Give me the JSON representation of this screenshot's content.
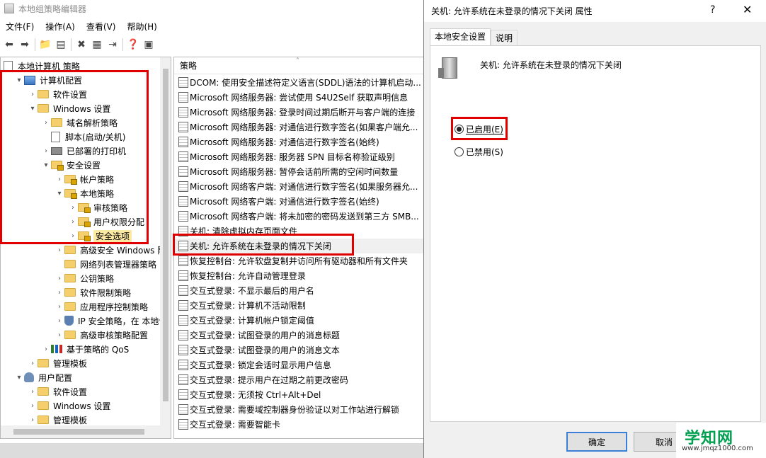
{
  "main_window": {
    "title": "本地组策略编辑器",
    "menu": [
      "文件(F)",
      "操作(A)",
      "查看(V)",
      "帮助(H)"
    ]
  },
  "tree": {
    "rows": [
      {
        "label": "本地计算机 策略",
        "indent": 0,
        "arrow": "",
        "icon": "doc-icon"
      },
      {
        "label": "计算机配置",
        "indent": 1,
        "arrow": "▾",
        "icon": "computer-icon"
      },
      {
        "label": "软件设置",
        "indent": 2,
        "arrow": "›",
        "icon": "folder-icon"
      },
      {
        "label": "Windows 设置",
        "indent": 2,
        "arrow": "▾",
        "icon": "folder-icon"
      },
      {
        "label": "域名解析策略",
        "indent": 3,
        "arrow": "›",
        "icon": "folder-icon"
      },
      {
        "label": "脚本(启动/关机)",
        "indent": 3,
        "arrow": "",
        "icon": "script-icon"
      },
      {
        "label": "已部署的打印机",
        "indent": 3,
        "arrow": "›",
        "icon": "printer-icon"
      },
      {
        "label": "安全设置",
        "indent": 3,
        "arrow": "▾",
        "icon": "lock-folder-icon"
      },
      {
        "label": "帐户策略",
        "indent": 4,
        "arrow": "›",
        "icon": "lock-folder-icon"
      },
      {
        "label": "本地策略",
        "indent": 4,
        "arrow": "▾",
        "icon": "lock-folder-icon"
      },
      {
        "label": "审核策略",
        "indent": 5,
        "arrow": "›",
        "icon": "lock-folder-icon"
      },
      {
        "label": "用户权限分配",
        "indent": 5,
        "arrow": "›",
        "icon": "lock-folder-icon"
      },
      {
        "label": "安全选项",
        "indent": 5,
        "arrow": "›",
        "icon": "lock-folder-icon",
        "selected": true
      },
      {
        "label": "高级安全 Windows 防",
        "indent": 4,
        "arrow": "›",
        "icon": "folder-icon"
      },
      {
        "label": "网络列表管理器策略",
        "indent": 4,
        "arrow": "",
        "icon": "folder-icon"
      },
      {
        "label": "公钥策略",
        "indent": 4,
        "arrow": "›",
        "icon": "folder-icon"
      },
      {
        "label": "软件限制策略",
        "indent": 4,
        "arrow": "›",
        "icon": "folder-icon"
      },
      {
        "label": "应用程序控制策略",
        "indent": 4,
        "arrow": "›",
        "icon": "folder-icon"
      },
      {
        "label": "IP 安全策略，在 本地计",
        "indent": 4,
        "arrow": "›",
        "icon": "shield-icon"
      },
      {
        "label": "高级审核策略配置",
        "indent": 4,
        "arrow": "›",
        "icon": "folder-icon"
      },
      {
        "label": "基于策略的 QoS",
        "indent": 3,
        "arrow": "›",
        "icon": "qos-icon"
      },
      {
        "label": "管理模板",
        "indent": 2,
        "arrow": "›",
        "icon": "folder-icon"
      },
      {
        "label": "用户配置",
        "indent": 1,
        "arrow": "▾",
        "icon": "user-icon"
      },
      {
        "label": "软件设置",
        "indent": 2,
        "arrow": "›",
        "icon": "folder-icon"
      },
      {
        "label": "Windows 设置",
        "indent": 2,
        "arrow": "›",
        "icon": "folder-icon"
      },
      {
        "label": "管理模板",
        "indent": 2,
        "arrow": "›",
        "icon": "folder-icon"
      }
    ]
  },
  "list": {
    "header": "策略",
    "rows": [
      "DCOM: 使用安全描述符定义语言(SDDL)语法的计算机启动...",
      "Microsoft 网络服务器: 尝试使用 S4U2Self 获取声明信息",
      "Microsoft 网络服务器: 登录时间过期后断开与客户端的连接",
      "Microsoft 网络服务器: 对通信进行数字签名(如果客户端允...",
      "Microsoft 网络服务器: 对通信进行数字签名(始终)",
      "Microsoft 网络服务器: 服务器 SPN 目标名称验证级别",
      "Microsoft 网络服务器: 暂停会话前所需的空闲时间数量",
      "Microsoft 网络客户端: 对通信进行数字签名(如果服务器允...",
      "Microsoft 网络客户端: 对通信进行数字签名(始终)",
      "Microsoft 网络客户端: 将未加密的密码发送到第三方 SMB...",
      "关机: 清除虚拟内存页面文件",
      "关机: 允许系统在未登录的情况下关闭",
      "恢复控制台: 允许软盘复制并访问所有驱动器和所有文件夹",
      "恢复控制台: 允许自动管理登录",
      "交互式登录: 不显示最后的用户名",
      "交互式登录: 计算机不活动限制",
      "交互式登录: 计算机帐户锁定阈值",
      "交互式登录: 试图登录的用户的消息标题",
      "交互式登录: 试图登录的用户的消息文本",
      "交互式登录: 锁定会话时显示用户信息",
      "交互式登录: 提示用户在过期之前更改密码",
      "交互式登录: 无须按 Ctrl+Alt+Del",
      "交互式登录: 需要域控制器身份验证以对工作站进行解锁",
      "交互式登录: 需要智能卡"
    ],
    "selected_index": 11
  },
  "dialog": {
    "title": "关机: 允许系统在未登录的情况下关闭 属性",
    "help": "?",
    "close": "✕",
    "tabs": [
      "本地安全设置",
      "说明"
    ],
    "heading": "关机: 允许系统在未登录的情况下关闭",
    "enabled_label": "已启用(E)",
    "disabled_label": "已禁用(S)",
    "ok": "确定",
    "cancel": "取消",
    "selected_option": "enabled"
  },
  "watermark": {
    "main": "学知网",
    "url": "www.jmqz1000.com"
  },
  "colors": {
    "highlight": "#e00000",
    "selected_node": "#fbe8a3",
    "default_button_border": "#3c7fd6"
  }
}
